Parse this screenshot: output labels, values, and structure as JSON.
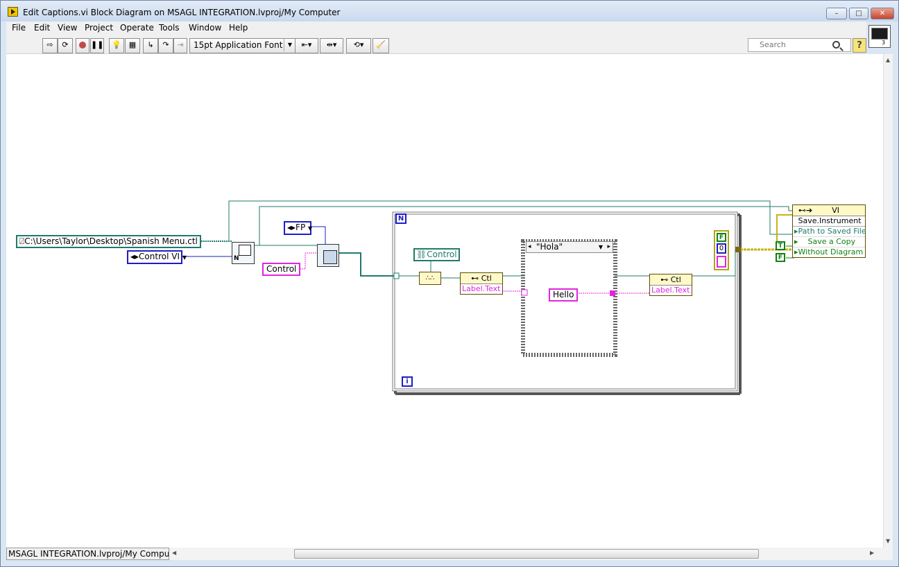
{
  "window": {
    "title": "Edit Captions.vi Block Diagram on MSAGL INTEGRATION.lvproj/My Computer",
    "min_label": "–",
    "max_label": "□",
    "close_label": "✕"
  },
  "menu": [
    "File",
    "Edit",
    "View",
    "Project",
    "Operate",
    "Tools",
    "Window",
    "Help"
  ],
  "toolbar": {
    "font": "15pt Application Font",
    "search_placeholder": "Search",
    "help": "?",
    "vi_icon_number": "3"
  },
  "diagram": {
    "path_constant": "C:\\Users\\Taylor\\Desktop\\Spanish Menu.ctl",
    "control_vi": "Control VI",
    "fp": "FP",
    "control_str": "Control",
    "control_ref": "Control",
    "ctl_prop_head": "Ctl",
    "label_text": "Label.Text",
    "case_selector": "\"Hola\"",
    "hello_str": "Hello",
    "ctl_prop_head2": "Ctl",
    "label_text2": "Label.Text",
    "loop_n": "N",
    "loop_i": "i",
    "numeric_zero": "0",
    "bool_f_top": "F",
    "invoke_class": "VI",
    "invoke_method": "Save.Instrument",
    "invoke_params": [
      "Path to Saved File",
      "Save a Copy",
      "Without Diagram"
    ],
    "bool_t": "T",
    "bool_f": "F"
  },
  "status": {
    "context": "MSAGL INTEGRATION.lvproj/My Computer"
  },
  "colors": {
    "path_wire": "#1f7a6a",
    "ref_wire": "#1d1dc6",
    "string_wire": "#e024e0",
    "bool_wire": "#138013",
    "error_wire": "#d6c020"
  }
}
